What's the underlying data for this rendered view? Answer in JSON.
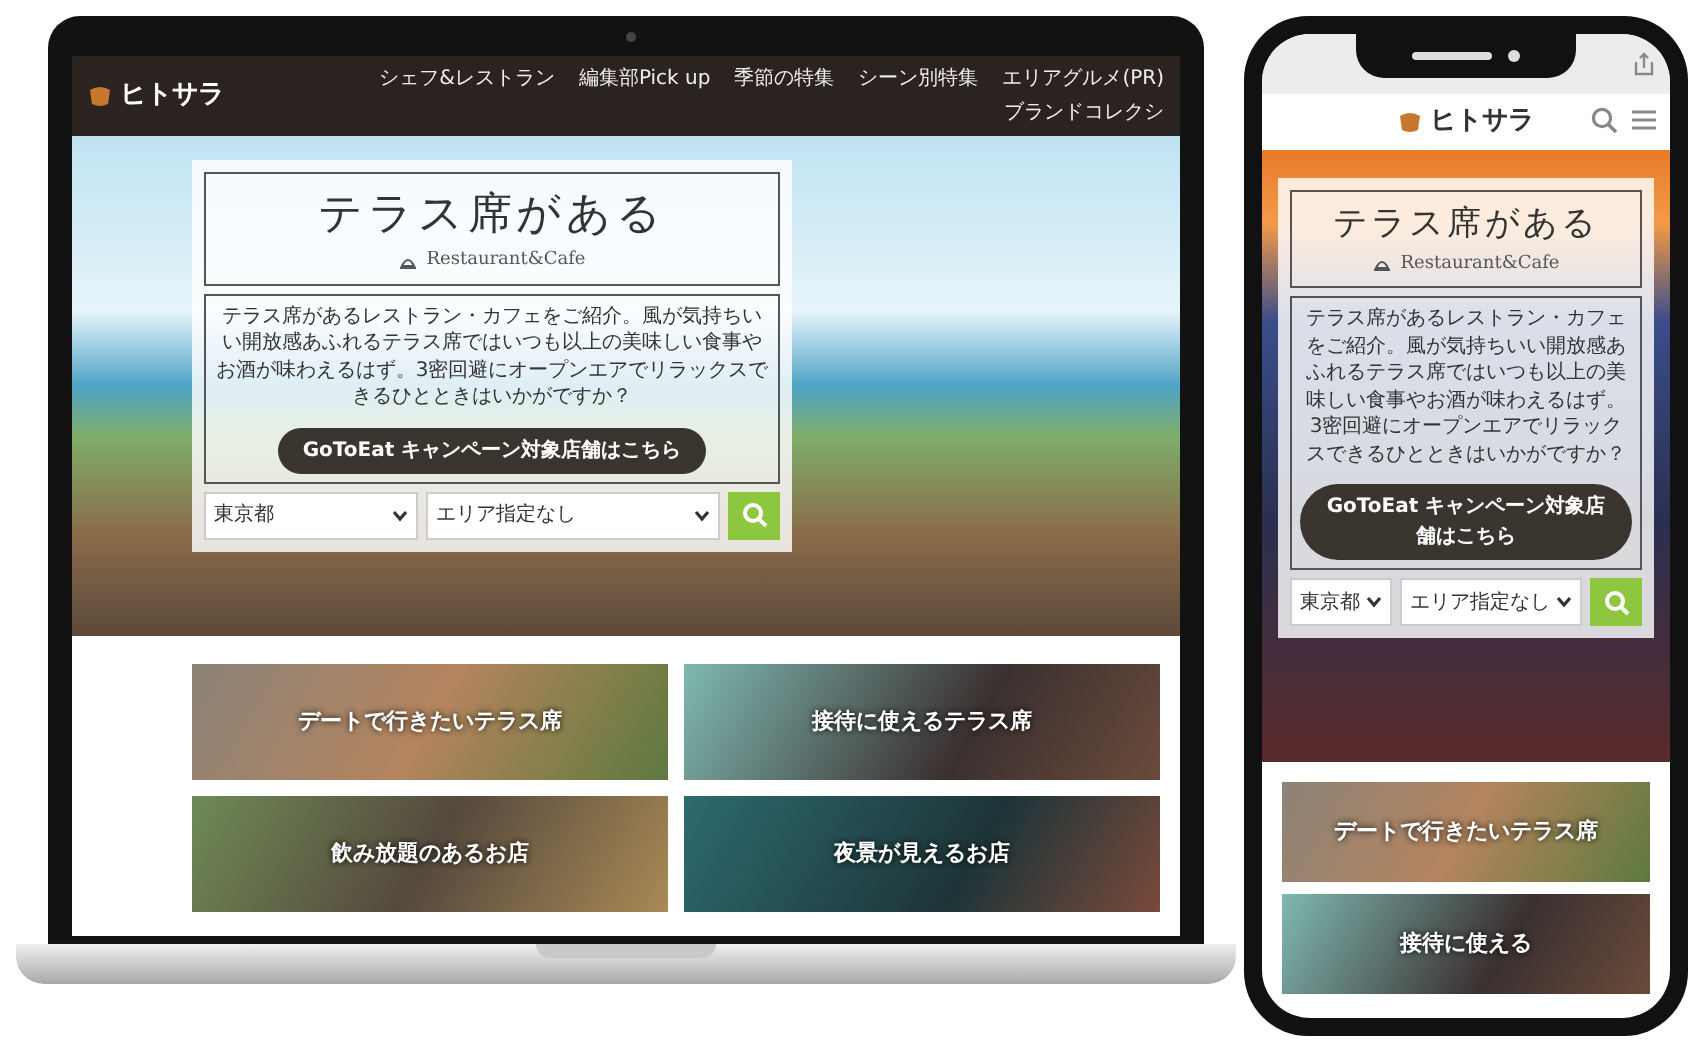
{
  "laptop": {
    "logo": "ヒトサラ",
    "nav": [
      "シェフ&レストラン",
      "編集部Pick up",
      "季節の特集",
      "シーン別特集",
      "エリアグルメ(PR)",
      "ブランドコレクシ"
    ],
    "hero": {
      "title": "テラス席がある",
      "subtitle": "Restaurant&Cafe",
      "text": "テラス席があるレストラン・カフェをご紹介。風が気持ちいい開放感あふれるテラス席ではいつも以上の美味しい食事やお酒が味わえるはず。3密回避にオープンエアでリラックスできるひとときはいかがですか？",
      "button": "GoToEat キャンペーン対象店舗はこちら",
      "prefecture": "東京都",
      "area": "エリア指定なし"
    },
    "tiles": [
      "デートで行きたいテラス席",
      "接待に使えるテラス席",
      "飲み放題のあるお店",
      "夜景が見えるお店"
    ]
  },
  "phone": {
    "logo": "ヒトサラ",
    "hero": {
      "title": "テラス席がある",
      "subtitle": "Restaurant&Cafe",
      "text": "テラス席があるレストラン・カフェをご紹介。風が気持ちいい開放感あふれるテラス席ではいつも以上の美味しい食事やお酒が味わえるはず。3密回避にオープンエアでリラックスできるひとときはいかがですか？",
      "button": "GoToEat キャンペーン対象店舗はこちら",
      "prefecture": "東京都",
      "area": "エリア指定なし"
    },
    "tiles": [
      "デートで行きたいテラス席",
      "接待に使える"
    ]
  }
}
